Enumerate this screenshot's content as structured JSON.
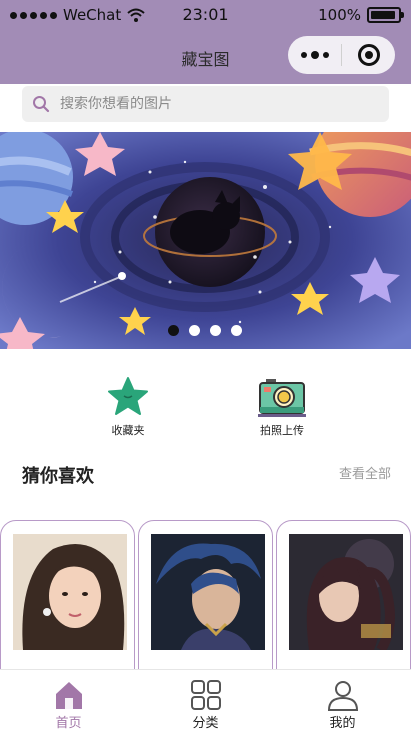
{
  "status_bar": {
    "carrier": "WeChat",
    "time": "23:01",
    "battery": "100%"
  },
  "nav": {
    "title": "藏宝图"
  },
  "search": {
    "placeholder": "搜索你想看的图片"
  },
  "banner": {
    "slide_count": 4,
    "active_index": 0
  },
  "shortcuts": [
    {
      "label": "收藏夹",
      "icon": "star-icon"
    },
    {
      "label": "拍照上传",
      "icon": "camera-icon"
    }
  ],
  "recommend": {
    "title": "猜你喜欢",
    "more": "查看全部",
    "cards": [
      {
        "name": ""
      },
      {
        "name": ""
      },
      {
        "name": ""
      }
    ]
  },
  "tabbar": {
    "items": [
      {
        "label": "首页",
        "icon": "home-icon",
        "active": true
      },
      {
        "label": "分类",
        "icon": "grid-icon",
        "active": false
      },
      {
        "label": "我的",
        "icon": "user-icon",
        "active": false
      }
    ]
  },
  "colors": {
    "header": "#a28cb6",
    "accent": "#a277a8",
    "star": "#2aa57a",
    "card_border": "#b89ac8"
  }
}
